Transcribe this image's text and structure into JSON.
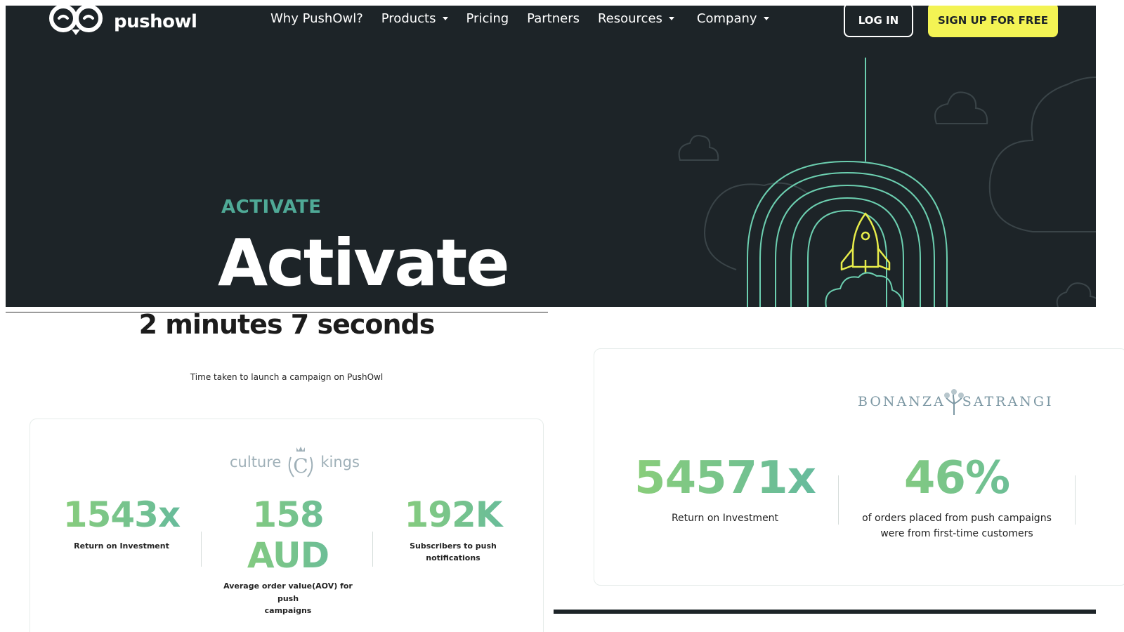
{
  "brand": {
    "name": "pushowl"
  },
  "nav": {
    "items": [
      {
        "label": "Why PushOwl?",
        "dropdown": false
      },
      {
        "label": "Products",
        "dropdown": true
      },
      {
        "label": "Pricing",
        "dropdown": false
      },
      {
        "label": "Partners",
        "dropdown": false
      },
      {
        "label": "Resources",
        "dropdown": true
      },
      {
        "label": "Company",
        "dropdown": true
      }
    ],
    "login_label": "LOG IN",
    "signup_label": "SIGN UP FOR FREE"
  },
  "hero": {
    "eyebrow": "ACTIVATE",
    "title": "Activate"
  },
  "time_stat": {
    "value": "2 minutes 7 seconds",
    "caption": "Time taken to launch a campaign on PushOwl"
  },
  "card_culture_kings": {
    "logo_left": "culture",
    "logo_mark": "C",
    "logo_right": "kings",
    "stats": [
      {
        "value": "1543x",
        "label": "Return on Investment"
      },
      {
        "value_line1": "158",
        "value_line2": "AUD",
        "label_line1": "Average order value(AOV) for push",
        "label_line2": "campaigns"
      },
      {
        "value": "192K",
        "label": "Subscribers to push notifications"
      }
    ]
  },
  "card_bonanza": {
    "logo_left": "BONANZA",
    "logo_right": "SATRANGI",
    "stats": [
      {
        "value": "54571x",
        "label": "Return on Investment"
      },
      {
        "value": "46%",
        "label_line1": "of orders placed from push campaigns",
        "label_line2": "were from first-time customers"
      }
    ]
  },
  "colors": {
    "hero_bg": "#1d2428",
    "accent_teal": "#4fa996",
    "cta_yellow": "#f3f354",
    "stat_green": "#8ccf77",
    "stat_teal": "#63b9a0"
  },
  "icons": [
    "owl-logo-icon",
    "caret-down-icon",
    "rocket-icon",
    "cloud-icon",
    "crest-icon",
    "tree-icon"
  ]
}
